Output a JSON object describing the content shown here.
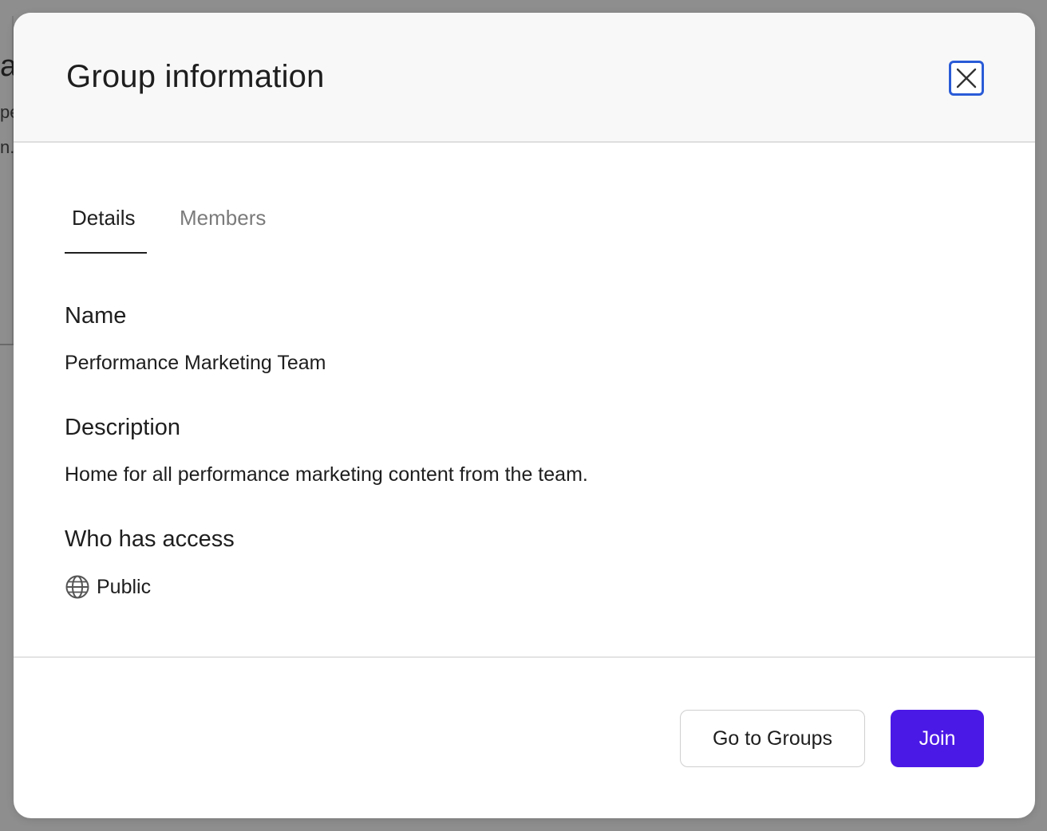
{
  "background": {
    "fragment_title": "ar",
    "fragment_line1": "pe",
    "fragment_line2": "n."
  },
  "modal": {
    "title": "Group information",
    "close_icon": "close-icon",
    "tabs": [
      {
        "label": "Details",
        "active": true
      },
      {
        "label": "Members",
        "active": false
      }
    ],
    "fields": {
      "name": {
        "label": "Name",
        "value": "Performance Marketing Team"
      },
      "description": {
        "label": "Description",
        "value": "Home for all performance marketing content from the team."
      },
      "access": {
        "label": "Who has access",
        "value": "Public",
        "icon": "globe-icon"
      }
    },
    "footer": {
      "secondary_label": "Go to Groups",
      "primary_label": "Join"
    }
  },
  "colors": {
    "primary": "#4b19e6",
    "focus_ring": "#2a5bd7",
    "overlay": "#8e8e8e"
  }
}
